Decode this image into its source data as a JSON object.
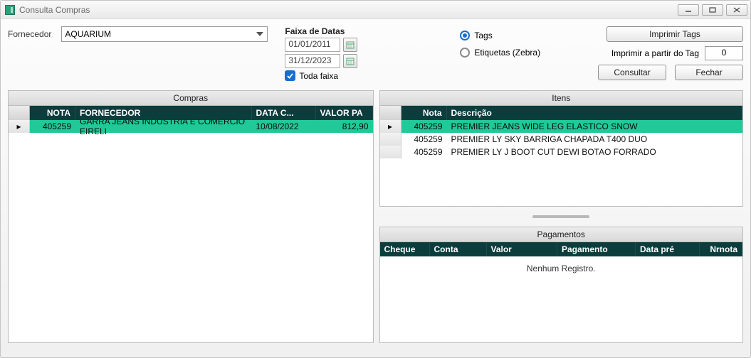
{
  "window": {
    "title": "Consulta Compras"
  },
  "filters": {
    "fornecedor_label": "Fornecedor",
    "fornecedor_value": "AQUARIUM",
    "faixa_label": "Faixa de Datas",
    "date_from": "01/01/2011",
    "date_to": "31/12/2023",
    "toda_faixa_label": "Toda faixa",
    "toda_faixa_checked": true,
    "radio_tags": "Tags",
    "radio_etiquetas": "Etiquetas (Zebra)",
    "radio_selected": "tags",
    "imprimir_a_partir_label": "Imprimir a partir do Tag",
    "tag_number": "0"
  },
  "buttons": {
    "imprimir_tags": "Imprimir Tags",
    "consultar": "Consultar",
    "fechar": "Fechar"
  },
  "compras": {
    "title": "Compras",
    "columns": {
      "nota": "NOTA",
      "fornecedor": "FORNECEDOR",
      "data": "DATA C...",
      "valor": "VALOR PA"
    },
    "rows": [
      {
        "nota": "405259",
        "fornecedor": "GARRA JEANS INDUSTRIA E COMERCIO EIRELI",
        "data": "10/08/2022",
        "valor": "812,90",
        "selected": true
      }
    ]
  },
  "itens": {
    "title": "Itens",
    "columns": {
      "nota": "Nota",
      "descricao": "Descrição"
    },
    "rows": [
      {
        "nota": "405259",
        "descricao": "PREMIER JEANS WIDE LEG ELASTICO SNOW",
        "selected": true
      },
      {
        "nota": "405259",
        "descricao": "PREMIER LY SKY BARRIGA CHAPADA T400 DUO",
        "selected": false
      },
      {
        "nota": "405259",
        "descricao": "PREMIER LY J BOOT CUT DEWI BOTAO FORRADO",
        "selected": false
      }
    ]
  },
  "pagamentos": {
    "title": "Pagamentos",
    "columns": {
      "cheque": "Cheque",
      "conta": "Conta",
      "valor": "Valor",
      "pagamento": "Pagamento",
      "data_pre": "Data pré",
      "nrnota": "Nrnota"
    },
    "empty": "Nenhum Registro."
  }
}
